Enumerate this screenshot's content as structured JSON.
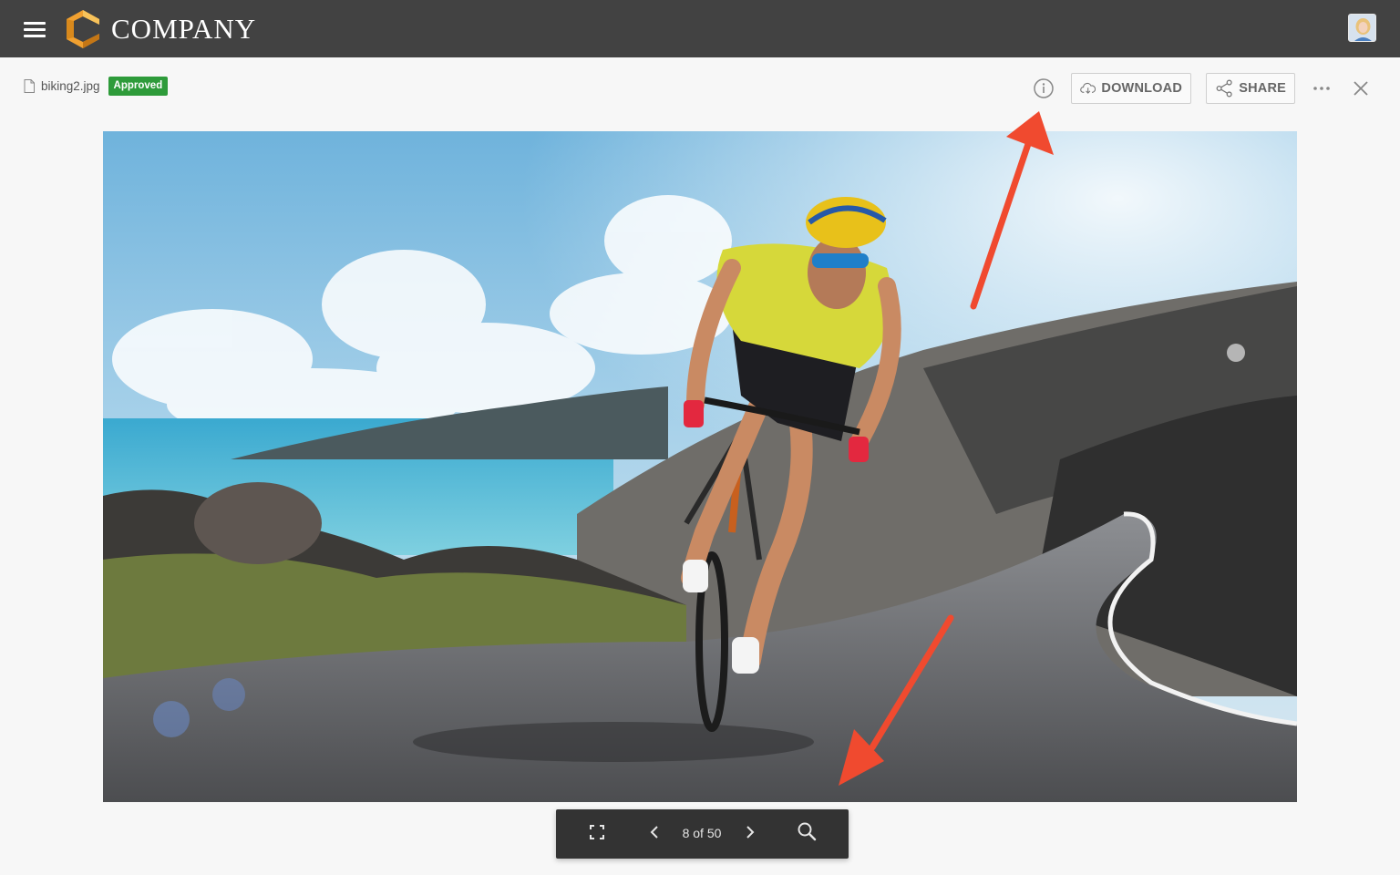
{
  "header": {
    "logo_text": "COMPANY",
    "menu_icon": "hamburger-menu-icon",
    "avatar": "user-avatar"
  },
  "file": {
    "name": "biking2.jpg",
    "status": "Approved",
    "status_color": "#2e9b3a"
  },
  "toolbar": {
    "download_label": "DOWNLOAD",
    "share_label": "SHARE",
    "icons": [
      "info-icon",
      "cloud-download-icon",
      "share-icon",
      "more-options-icon",
      "close-icon"
    ]
  },
  "viewer": {
    "image_subject": "cyclist on coastal road",
    "pagination": {
      "current": 8,
      "total": 50,
      "label": "8 of 50"
    },
    "controls": [
      "fullscreen-icon",
      "previous-icon",
      "next-icon",
      "zoom-icon"
    ]
  },
  "annotations": {
    "arrow_color": "#f04a2f"
  },
  "colors": {
    "topbar": "#424242",
    "logo_orange": "#f0a030",
    "controls_bg": "#333333"
  }
}
